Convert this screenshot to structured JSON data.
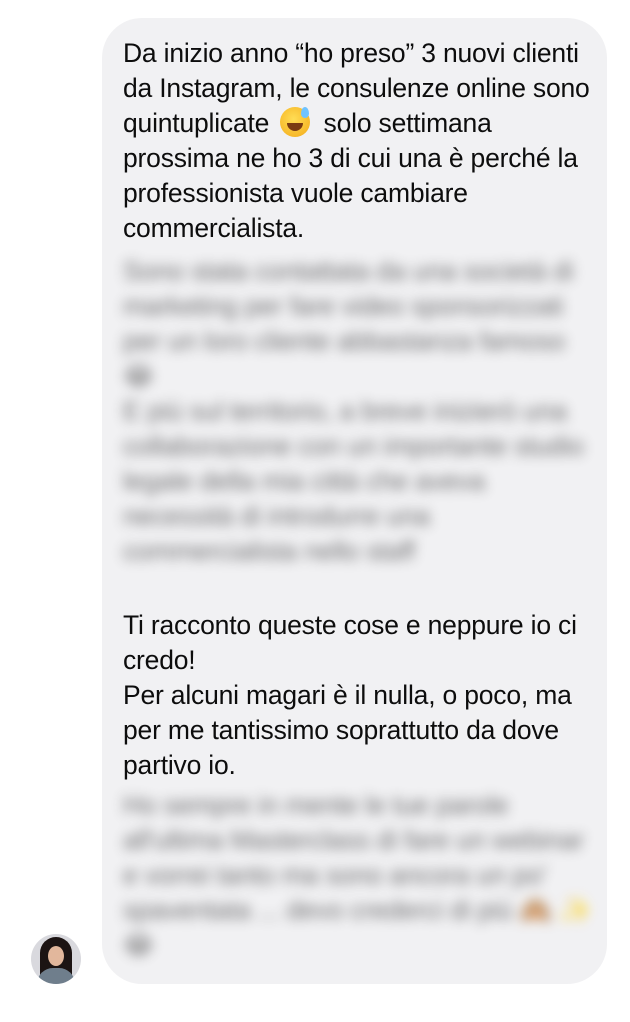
{
  "message": {
    "paragraph_1_before_emoji": "Da inizio anno “ho preso” 3 nuovi clienti da Instagram, le consulenze online sono quintuplicate",
    "paragraph_1_after_emoji": "solo settimana prossima ne ho 3 di cui una è perché la professionista vuole cambiare commercialista.",
    "paragraph_1_emoji": "grinning-face-with-sweat-icon",
    "blurred_block_1": "Sono stata contattata da una società di marketing per fare video sponsorizzati per un loro cliente abbastanza famoso 😂\nE più sul territorio, a breve inizierò una collaborazione con un importante studio legale della mia città che aveva necessità di introdurre una commercialista nello staff",
    "paragraph_2": "Ti racconto queste cose e neppure io ci credo!",
    "paragraph_3": "Per alcuni magari è il nulla, o poco, ma per me tantissimo soprattutto da dove partivo io.",
    "blurred_block_2": "Ho sempre in mente le tue parole all'ultima Masterclass di fare un webinar e vorrei tanto ma sono ancora un po' spaventata ... devo crederci di più 🙈 ✨ 😂"
  },
  "sender": {
    "avatar": "avatar-photo-woman"
  },
  "colors": {
    "bubble_background": "#f1f1f3",
    "text": "#0d0d0d",
    "page_background": "#ffffff"
  }
}
